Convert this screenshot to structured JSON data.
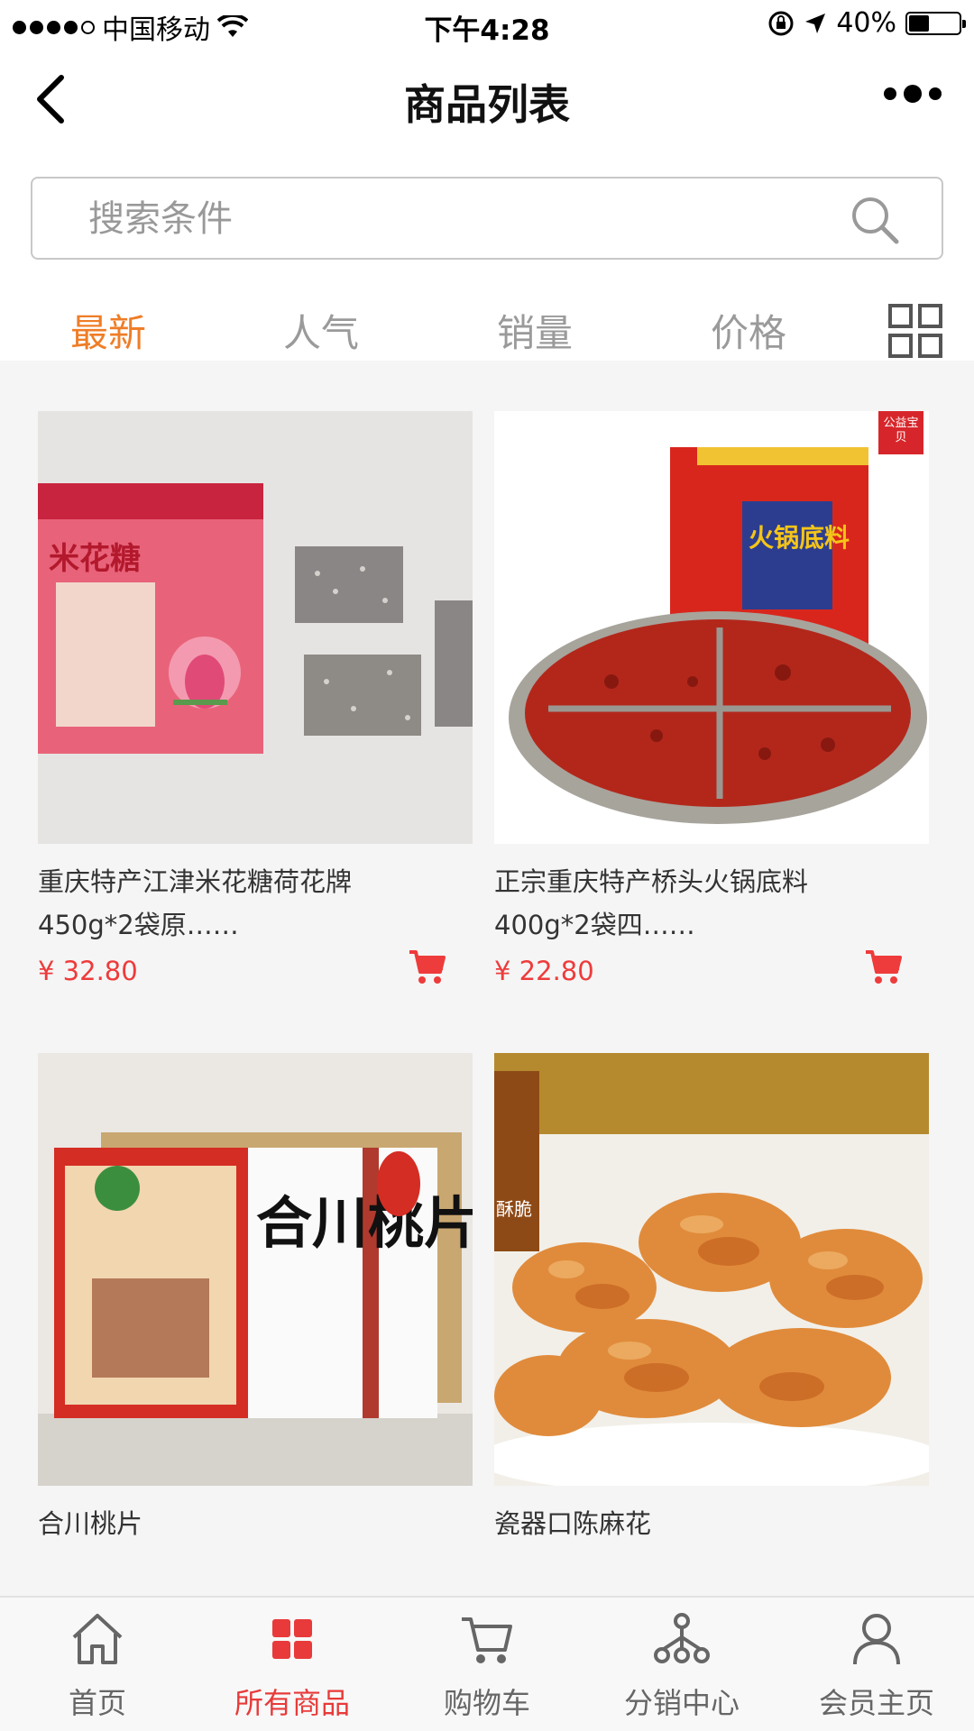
{
  "status_bar": {
    "carrier": "中国移动",
    "time": "下午4:28",
    "battery_percent": "40%",
    "battery_level": 0.4
  },
  "nav": {
    "title": "商品列表"
  },
  "search": {
    "placeholder": "搜索条件"
  },
  "tabs": [
    {
      "label": "最新",
      "active": true
    },
    {
      "label": "人气",
      "active": false
    },
    {
      "label": "销量",
      "active": false
    },
    {
      "label": "价格",
      "active": false
    }
  ],
  "products": [
    {
      "name": "重庆特产江津米花糖荷花牌450g*2袋原……",
      "price": "¥ 32.80",
      "image_text": "米花糖"
    },
    {
      "name": "正宗重庆特产桥头火锅底料400g*2袋四……",
      "price": "¥ 22.80",
      "badge": "公益宝贝",
      "image_text": "火锅底料"
    },
    {
      "name": "合川桃片",
      "image_text": "合川桃片"
    },
    {
      "name": "瓷器口陈麻花",
      "image_text": "酥脆"
    }
  ],
  "tab_bar": [
    {
      "label": "首页",
      "icon": "home-icon",
      "active": false
    },
    {
      "label": "所有商品",
      "icon": "grid-icon",
      "active": true
    },
    {
      "label": "购物车",
      "icon": "cart-icon",
      "active": false
    },
    {
      "label": "分销中心",
      "icon": "network-icon",
      "active": false
    },
    {
      "label": "会员主页",
      "icon": "user-icon",
      "active": false
    }
  ],
  "colors": {
    "accent_orange": "#ef7d27",
    "price_red": "#ee3b3b",
    "tabbar_active": "#e83a3a"
  }
}
